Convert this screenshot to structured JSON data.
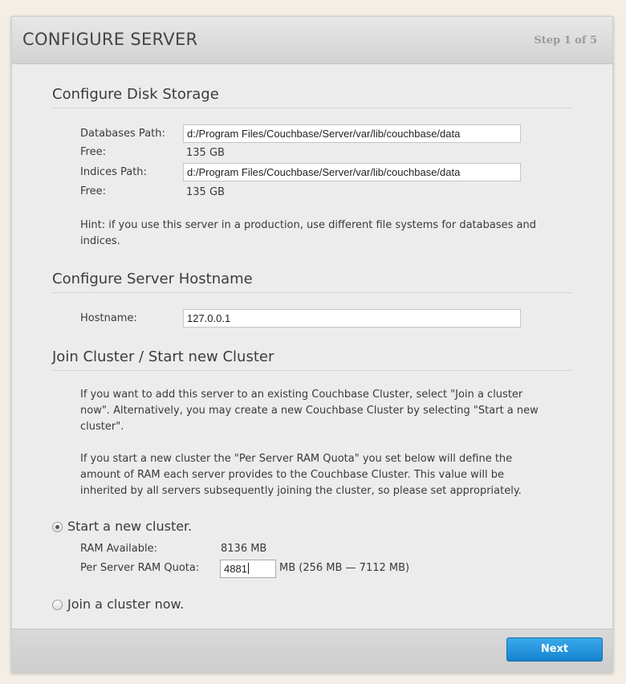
{
  "header": {
    "title": "CONFIGURE SERVER",
    "step": "Step 1 of 5"
  },
  "disk_storage": {
    "title": "Configure Disk Storage",
    "databases_path_label": "Databases Path:",
    "databases_path_value": "d:/Program Files/Couchbase/Server/var/lib/couchbase/data",
    "databases_free_label": "Free:",
    "databases_free_value": "135 GB",
    "indices_path_label": "Indices Path:",
    "indices_path_value": "d:/Program Files/Couchbase/Server/var/lib/couchbase/data",
    "indices_free_label": "Free:",
    "indices_free_value": "135 GB",
    "hint": "Hint: if you use this server in a production, use different file systems for databases and indices."
  },
  "hostname": {
    "title": "Configure Server Hostname",
    "label": "Hostname:",
    "value": "127.0.0.1"
  },
  "cluster": {
    "title": "Join Cluster / Start new Cluster",
    "para1": "If you want to add this server to an existing Couchbase Cluster, select \"Join a cluster now\". Alternatively, you may create a new Couchbase Cluster by selecting \"Start a new cluster\".",
    "para2": "If you start a new cluster the \"Per Server RAM Quota\" you set below will define the amount of RAM each server provides to the Couchbase Cluster. This value will be inherited by all servers subsequently joining the cluster, so please set appropriately.",
    "start_new_label": "Start a new cluster.",
    "start_new_selected": true,
    "ram_available_label": "RAM Available:",
    "ram_available_value": "8136 MB",
    "ram_quota_label": "Per Server RAM Quota:",
    "ram_quota_value": "4881",
    "ram_quota_hint": "MB (256 MB — 7112 MB)",
    "join_label": "Join a cluster now.",
    "join_selected": false
  },
  "footer": {
    "next_label": "Next"
  }
}
